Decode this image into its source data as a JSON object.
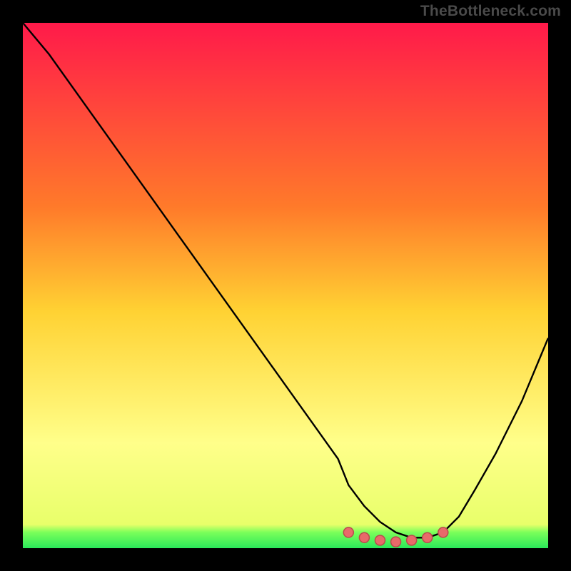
{
  "watermark": "TheBottleneck.com",
  "colors": {
    "bg": "#000000",
    "gradient_top": "#ff1a4a",
    "gradient_mid": "#ffd233",
    "gradient_low": "#ffff8a",
    "gradient_bottom": "#2ae85a",
    "line": "#000000",
    "marker_fill": "#e86a6a",
    "marker_stroke": "#b94b4b"
  },
  "chart_data": {
    "type": "line",
    "title": "",
    "xlabel": "",
    "ylabel": "",
    "xlim": [
      0,
      100
    ],
    "ylim": [
      0,
      100
    ],
    "x": [
      0,
      5,
      10,
      15,
      20,
      25,
      30,
      35,
      40,
      45,
      50,
      55,
      60,
      62,
      65,
      68,
      71,
      74,
      77,
      80,
      83,
      86,
      90,
      95,
      100
    ],
    "values": [
      100,
      94,
      87,
      80,
      73,
      66,
      59,
      52,
      45,
      38,
      31,
      24,
      17,
      12,
      8,
      5,
      3,
      2,
      2,
      3,
      6,
      11,
      18,
      28,
      40
    ],
    "markers_x": [
      62,
      65,
      68,
      71,
      74,
      77,
      80
    ],
    "markers_y": [
      3,
      2,
      1.5,
      1.2,
      1.5,
      2,
      3
    ],
    "gradient_stops": [
      {
        "offset": 0.0,
        "color": "#ff1a4a"
      },
      {
        "offset": 0.35,
        "color": "#ff7a2a"
      },
      {
        "offset": 0.55,
        "color": "#ffd233"
      },
      {
        "offset": 0.8,
        "color": "#ffff8a"
      },
      {
        "offset": 0.955,
        "color": "#e8ff6a"
      },
      {
        "offset": 0.97,
        "color": "#7aff5a"
      },
      {
        "offset": 1.0,
        "color": "#2ae85a"
      }
    ]
  }
}
